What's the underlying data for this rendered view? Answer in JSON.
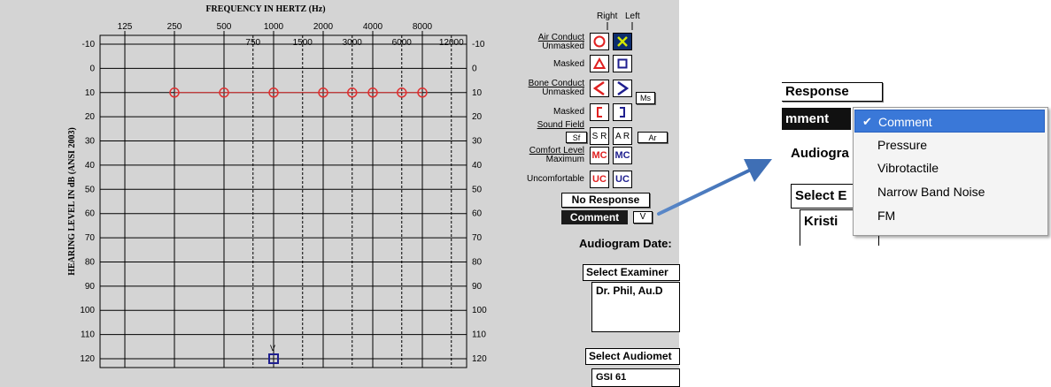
{
  "chart": {
    "title": "FREQUENCY IN HERTZ (Hz)",
    "y_label": "HEARING LEVEL IN dB (ANSI 2003)",
    "top_freq_labels": [
      "125",
      "250",
      "500",
      "1000",
      "2000",
      "4000",
      "8000"
    ],
    "mid_freq_labels": [
      "750",
      "1500",
      "3000",
      "6000",
      "12000"
    ],
    "y_ticks": [
      "-10",
      "0",
      "10",
      "20",
      "30",
      "40",
      "50",
      "60",
      "70",
      "80",
      "90",
      "100",
      "110",
      "120"
    ],
    "vibrotactile_marker": "V"
  },
  "chart_data": {
    "type": "line",
    "title": "FREQUENCY IN HERTZ (Hz)",
    "xlabel": "",
    "ylabel": "HEARING LEVEL IN dB (ANSI 2003)",
    "ylim": [
      -10,
      120
    ],
    "y_inverted": true,
    "x_scale": "log",
    "grid": true,
    "series": [
      {
        "name": "Air Conduct Unmasked",
        "symbol": "O",
        "color": "#e03030",
        "x": [
          250,
          500,
          1000,
          2000,
          3000,
          4000,
          6000,
          8000
        ],
        "y": [
          10,
          10,
          10,
          10,
          10,
          10,
          10,
          10
        ]
      }
    ],
    "annotations": [
      {
        "label": "V",
        "x": 1000,
        "y": 120,
        "color": "#1f1f8f"
      }
    ]
  },
  "legend": {
    "right_label": "Right",
    "left_label": "Left",
    "rows": [
      {
        "label_top": "Air Conduct",
        "label_bottom": "Unmasked",
        "right": "O",
        "left": "X"
      },
      {
        "label_top": "",
        "label_bottom": "Masked",
        "right": "Δ",
        "left": "□"
      },
      {
        "label_top": "Bone Conduct",
        "label_bottom": "Unmasked",
        "right": "<",
        "left": ">"
      },
      {
        "label_top": "",
        "label_bottom": "Masked",
        "right": "[",
        "left": "]"
      },
      {
        "label_top": "Sound Field",
        "label_bottom": "",
        "right": "S R",
        "left": "A R"
      },
      {
        "label_top": "Comfort Level",
        "label_bottom": "Maximum",
        "right": "MC",
        "left": "MC"
      },
      {
        "label_top": "",
        "label_bottom": "Uncomfortable",
        "right": "UC",
        "left": "UC"
      }
    ],
    "ms_button": "Ms",
    "sf_button": "Sf",
    "ar_button": "Ar",
    "colors": {
      "right": "#e02020",
      "left": "#1f1f8f",
      "left_x": "#c8d800"
    }
  },
  "controls": {
    "no_response": "No Response",
    "comment": "Comment",
    "comment_dropdown": "V",
    "audiogram_date_label": "Audiogram Date:",
    "examiner_title": "Select Examiner",
    "examiner_value": "Dr. Phil, Au.D",
    "audiometer_title": "Select Audiomet",
    "audiometer_value": "GSI 61"
  },
  "zoom": {
    "response_label": "Response",
    "comment_label": "mment",
    "audiogram_label": "Audiogra",
    "select_label": "Select E",
    "kristi_label": "Kristi",
    "menu_items": [
      "Comment",
      "Pressure",
      "Vibrotactile",
      "Narrow Band Noise",
      "FM"
    ],
    "selected_index": 0,
    "checkmark": "✔",
    "highlight_color": "#3a78d8"
  }
}
